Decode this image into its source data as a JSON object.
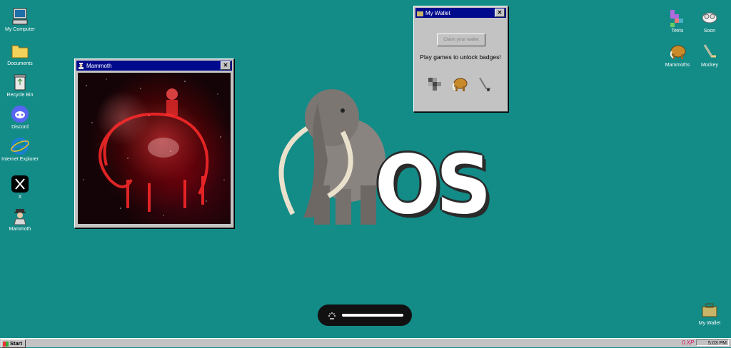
{
  "desktop_left": [
    {
      "label": "My Computer",
      "icon": "computer-icon"
    },
    {
      "label": "Documents",
      "icon": "folder-icon"
    },
    {
      "label": "Recycle Bin",
      "icon": "recycle-bin-icon"
    },
    {
      "label": "Discord",
      "icon": "discord-icon"
    },
    {
      "label": "Internet Explorer",
      "icon": "internet-explorer-icon"
    },
    {
      "label": "X",
      "icon": "x-logo-icon"
    },
    {
      "label": "Mammoth",
      "icon": "agent-icon"
    }
  ],
  "desktop_right": [
    {
      "label": "Tetris",
      "icon": "tetris-icon"
    },
    {
      "label": "Soon",
      "icon": "soon-icon"
    },
    {
      "label": "Mammoths",
      "icon": "mammoth-icon"
    },
    {
      "label": "Mockey",
      "icon": "hockey-stick-icon"
    },
    {
      "label": "My Wallet",
      "icon": "wallet-icon"
    }
  ],
  "mammoth_window": {
    "title": "Mammoth",
    "close": "✕"
  },
  "wallet_window": {
    "title": "My Wallet",
    "close": "✕",
    "claim_label": "Claim your wallet",
    "message": "Play games to unlock badges!"
  },
  "logo": {
    "text": "OS"
  },
  "taskbar": {
    "start_label": "Start",
    "brand": "0.XP",
    "clock": "5:03 PM"
  },
  "colors": {
    "desktop": "#138b87",
    "titlebar": "#000a8c",
    "chrome": "#c3c3c3"
  }
}
